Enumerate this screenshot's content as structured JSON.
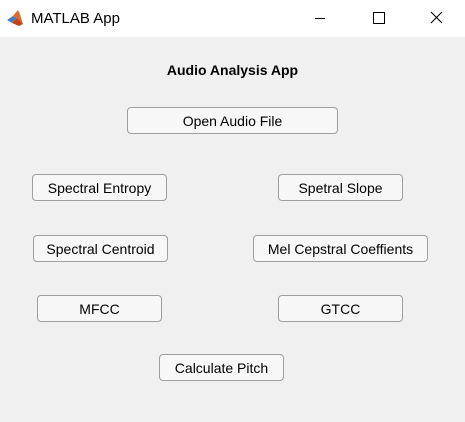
{
  "window": {
    "title": "MATLAB App",
    "icon": "matlab-logo-icon",
    "controls": [
      "minimize-icon",
      "maximize-icon",
      "close-icon"
    ]
  },
  "app": {
    "heading": "Audio Analysis App",
    "buttons": {
      "open_audio_file": "Open Audio File",
      "spectral_entropy": "Spectral Entropy",
      "spectral_slope": "Spetral Slope",
      "spectral_centroid": "Spectral Centroid",
      "mel_cepstral": "Mel Cepstral Coeffients",
      "mfcc": "MFCC",
      "gtcc": "GTCC",
      "calculate_pitch": "Calculate Pitch"
    }
  },
  "colors": {
    "titlebar": "#ffffff",
    "background": "#f0f0f0",
    "button_face": "#f7f7f7",
    "button_border": "#9e9e9e"
  }
}
